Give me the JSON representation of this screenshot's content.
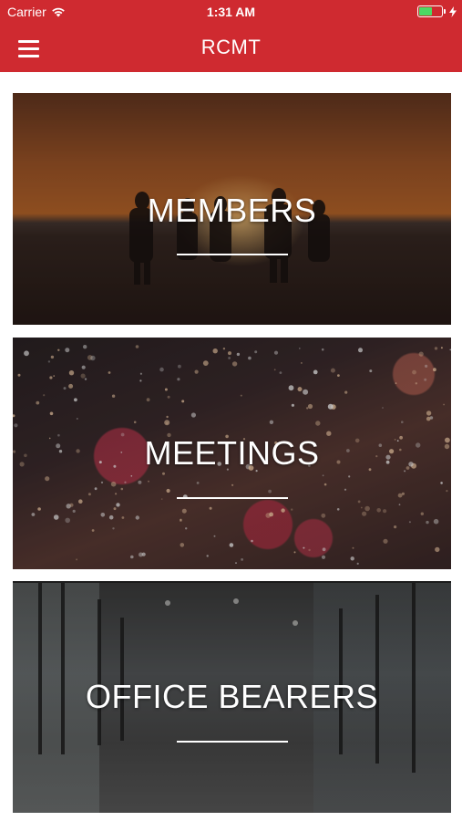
{
  "status_bar": {
    "carrier": "Carrier",
    "time": "1:31 AM",
    "wifi_icon": "wifi-icon",
    "battery_icon": "battery-icon",
    "charging_icon": "charging-bolt-icon",
    "battery_level": 0.6
  },
  "nav": {
    "title": "RCMT",
    "menu_icon": "hamburger-menu-icon"
  },
  "cards": [
    {
      "title": "MEMBERS"
    },
    {
      "title": "MEETINGS"
    },
    {
      "title": "OFFICE BEARERS"
    }
  ],
  "colors": {
    "header": "#cf2a30",
    "text": "#ffffff",
    "battery": "#4cd964"
  }
}
